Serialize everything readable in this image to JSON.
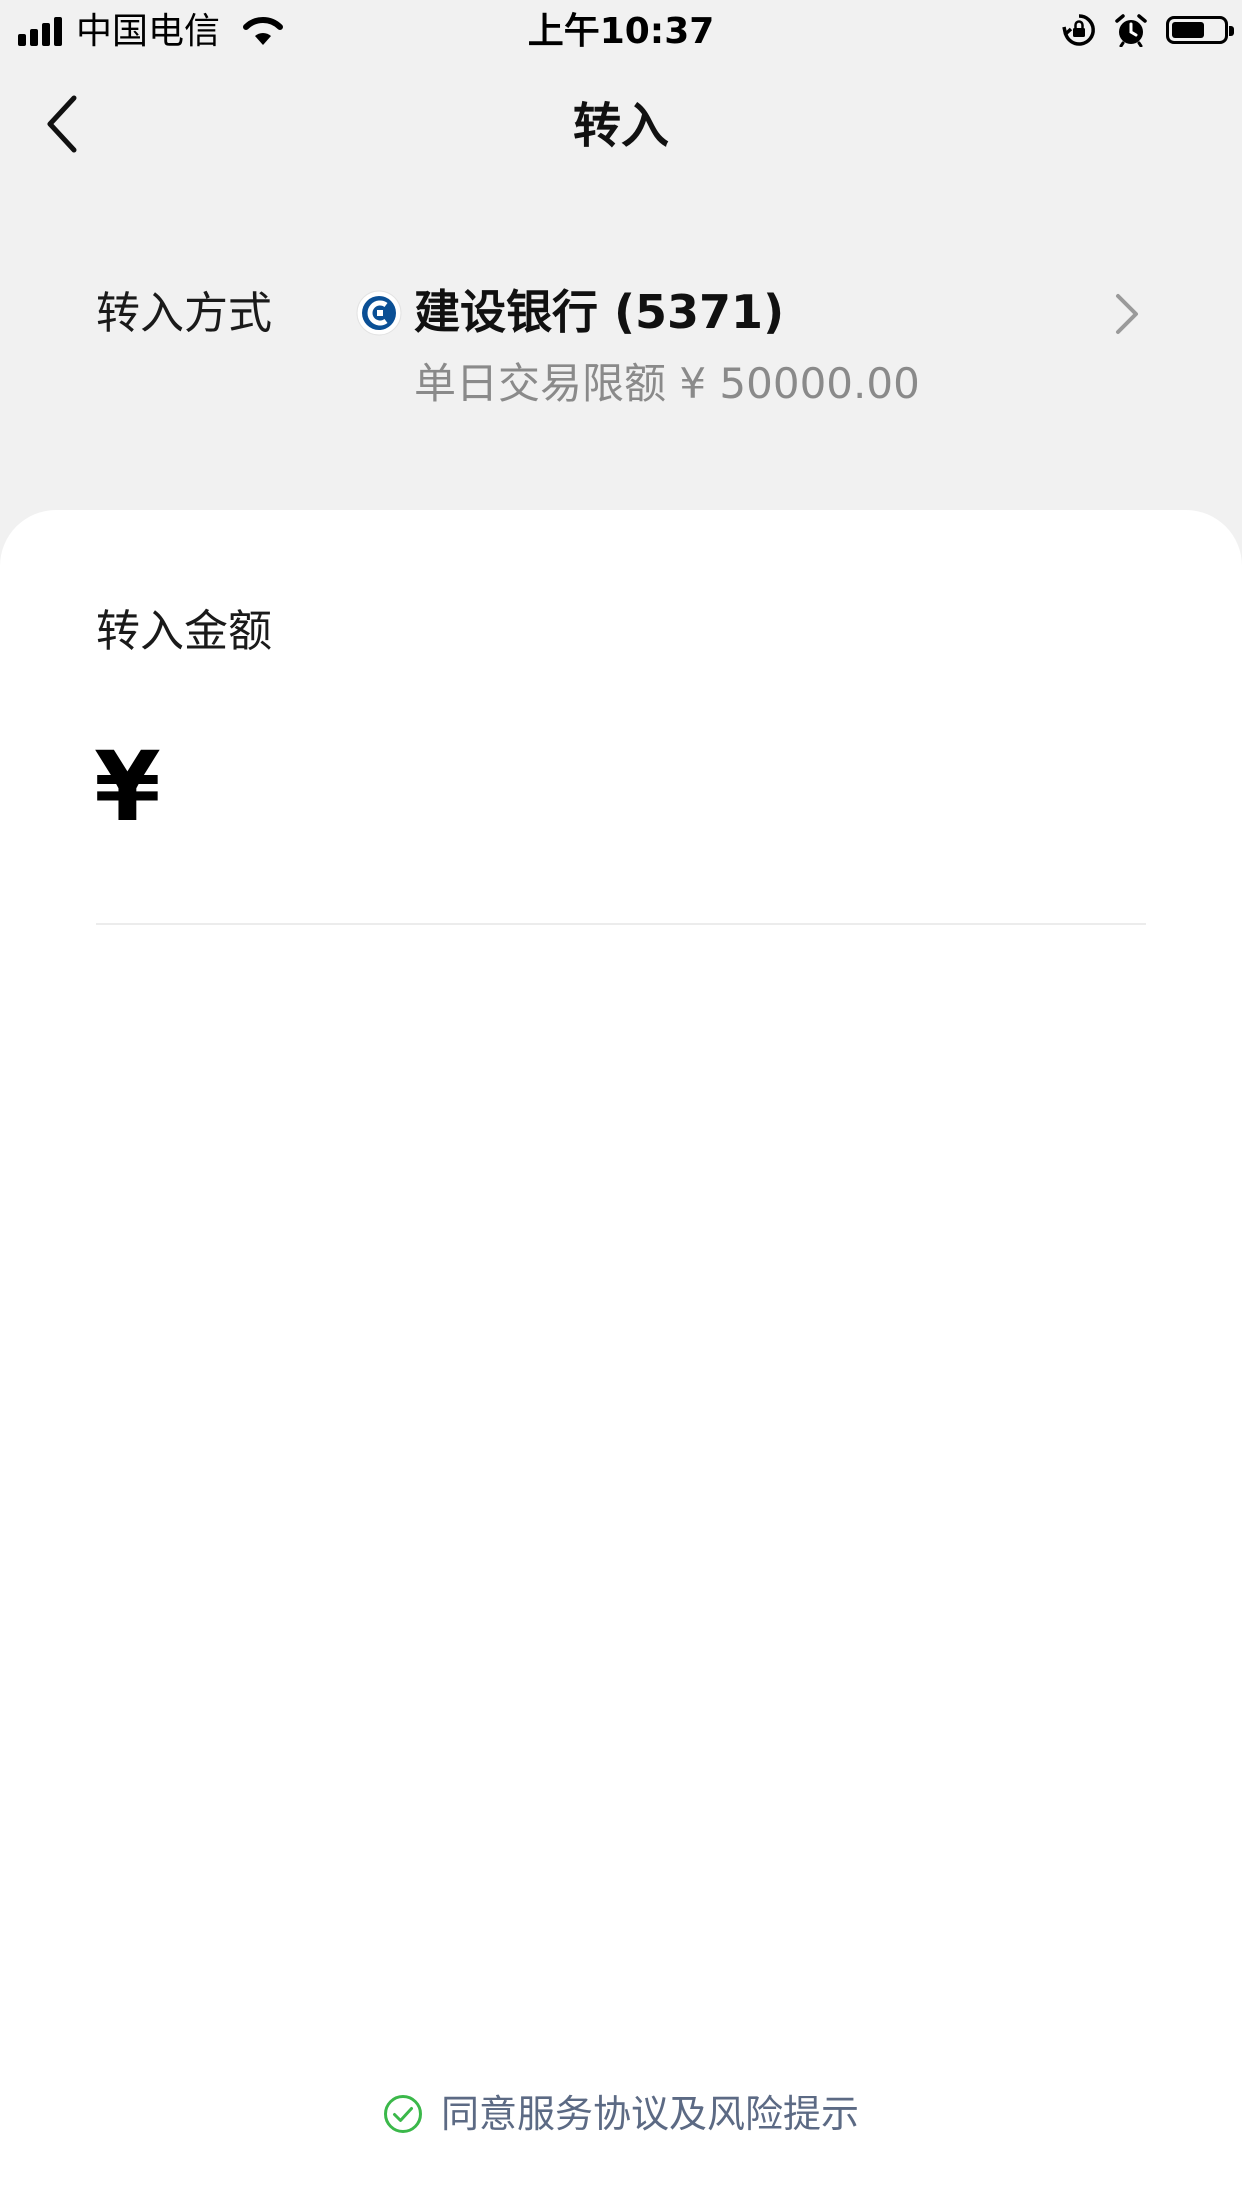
{
  "status_bar": {
    "carrier": "中国电信",
    "time": "上午10:37",
    "battery_level": 0.68
  },
  "nav": {
    "title": "转入"
  },
  "transfer_method": {
    "label": "转入方式",
    "bank_name": "建设银行 (5371)",
    "limit_text": "单日交易限额 ¥ 50000.00"
  },
  "amount": {
    "label": "转入金额",
    "currency_symbol": "¥",
    "value": ""
  },
  "agreement": {
    "text": "同意服务协议及风险提示"
  },
  "colors": {
    "background": "#f1f1f1",
    "card": "#ffffff",
    "check_green": "#3bb84a",
    "bank_blue": "#0a4f95",
    "agreement_text": "#5c6a84"
  }
}
